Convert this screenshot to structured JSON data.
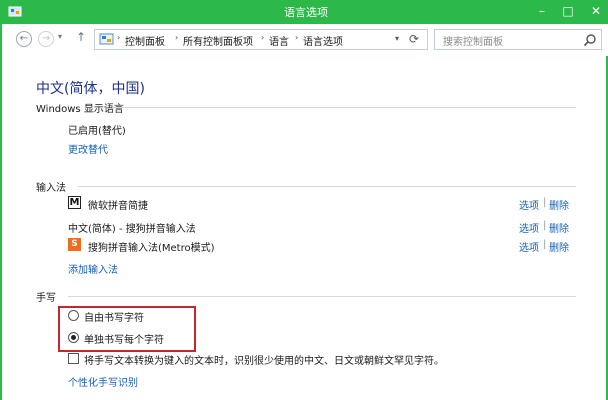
{
  "window": {
    "title": "语言选项"
  },
  "nav": {
    "breadcrumbs": [
      "控制面板",
      "所有控制面板项",
      "语言",
      "语言选项"
    ],
    "search_placeholder": "搜索控制面板"
  },
  "page": {
    "title": "中文(简体，中国)"
  },
  "display_language": {
    "label": "Windows 显示语言",
    "status": "已启用(替代)",
    "change_link": "更改替代"
  },
  "input_method": {
    "label": "输入法",
    "items": [
      {
        "icon": "microsoft-pinyin-icon",
        "glyph": "M",
        "name": "微软拼音简捷",
        "options": "选项",
        "remove": "删除"
      },
      {
        "icon": "",
        "glyph": "",
        "name": "中文(简体) - 搜狗拼音输入法",
        "options": "选项",
        "remove": "删除"
      },
      {
        "icon": "sogou-icon",
        "glyph": "S",
        "name": "搜狗拼音输入法(Metro模式)",
        "options": "选项",
        "remove": "删除"
      }
    ],
    "add_link": "添加输入法"
  },
  "handwriting": {
    "label": "手写",
    "options": [
      {
        "label": "自由书写字符",
        "checked": false
      },
      {
        "label": "单独书写每个字符",
        "checked": true
      }
    ],
    "checkbox_label": "将手写文本转换为键入的文本时，识别很少使用的中文、日文或朝鲜文罕见字符。",
    "checkbox_checked": false,
    "personalize_link": "个性化手写识别"
  },
  "colors": {
    "accent": "#2db84a",
    "link": "#1560b8",
    "title": "#1e3287",
    "highlight": "#c0282c"
  }
}
